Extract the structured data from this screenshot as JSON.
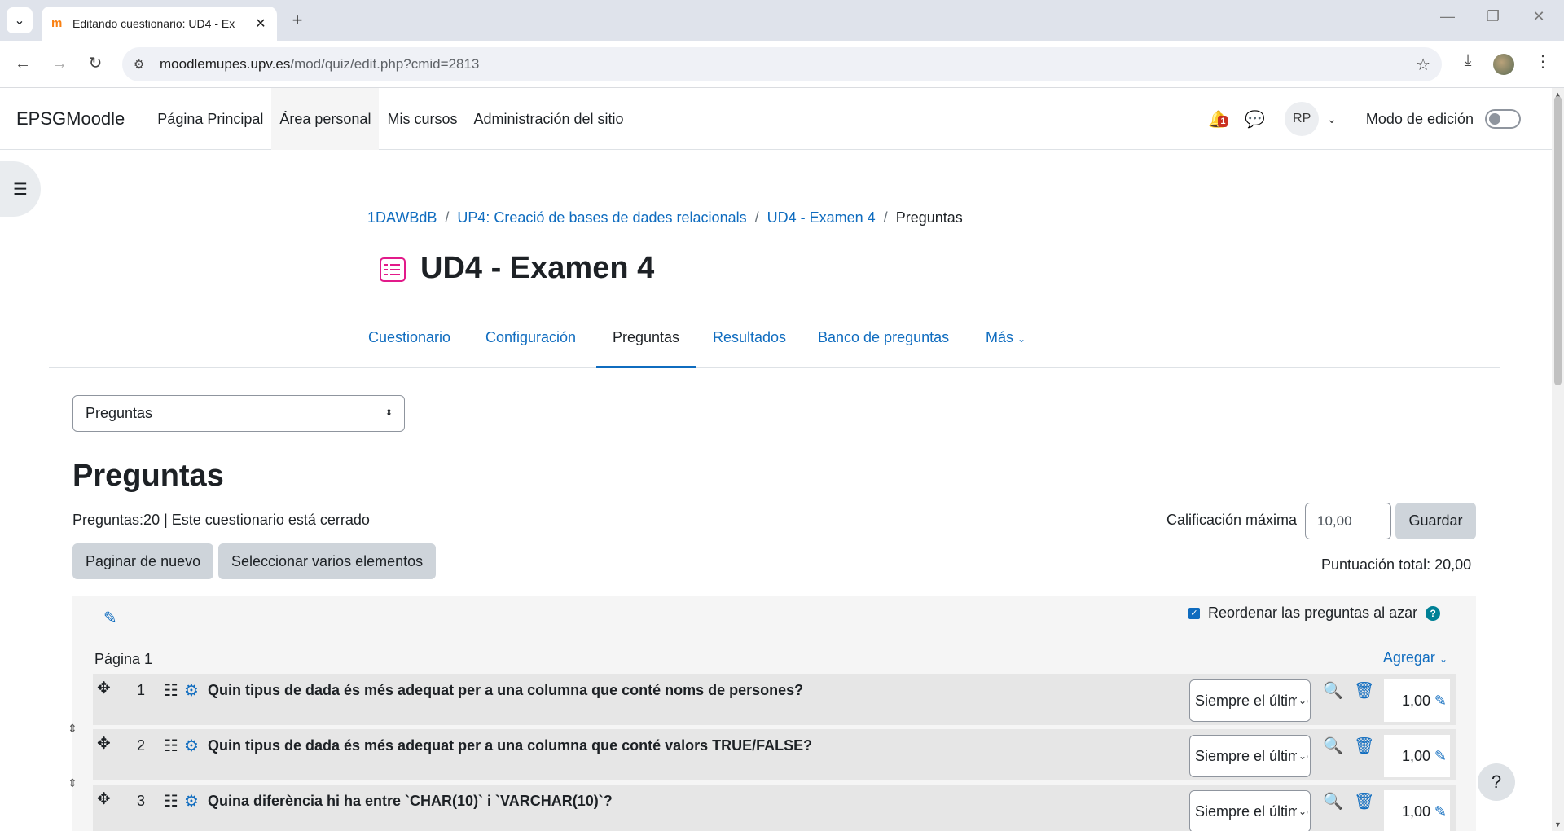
{
  "browser": {
    "tab_title": "Editando cuestionario: UD4 - Ex",
    "url_host": "moodlemupes.upv.es",
    "url_path": "/mod/quiz/edit.php?cmid=2813"
  },
  "nav": {
    "brand": "EPSGMoodle",
    "items": [
      "Página Principal",
      "Área personal",
      "Mis cursos",
      "Administración del sitio"
    ],
    "notification_count": "1",
    "user_initials": "RP",
    "edit_mode_label": "Modo de edición"
  },
  "breadcrumb": [
    "1DAWBdB",
    "UP4: Creació de bases de dades relacionals",
    "UD4 - Examen 4",
    "Preguntas"
  ],
  "page_title": "UD4 - Examen 4",
  "secondary_tabs": [
    "Cuestionario",
    "Configuración",
    "Preguntas",
    "Resultados",
    "Banco de preguntas",
    "Más"
  ],
  "selector_value": "Preguntas",
  "section_heading": "Preguntas",
  "questions_info": "Preguntas:20 | Este cuestionario está cerrado",
  "buttons": {
    "repaginate": "Paginar de nuevo",
    "select_multiple": "Seleccionar varios elementos",
    "save": "Guardar"
  },
  "max_grade_label": "Calificación máxima",
  "max_grade_value": "10,00",
  "total_label": "Puntuación total: 20,00",
  "shuffle_label": "Reordenar las preguntas al azar",
  "page_label": "Página 1",
  "add_label": "Agregar",
  "questions": [
    {
      "num": "1",
      "text": "Quin tipus de dada és més adequat per a una columna que conté noms de persones?",
      "select": "Siempre el último",
      "mark": "1,00"
    },
    {
      "num": "2",
      "text": "Quin tipus de dada és més adequat per a una columna que conté valors TRUE/FALSE?",
      "select": "Siempre el último",
      "mark": "1,00"
    },
    {
      "num": "3",
      "text": "Quina diferència hi ha entre `CHAR(10)` i `VARCHAR(10)`?",
      "select": "Siempre el último",
      "mark": "1,00"
    }
  ]
}
